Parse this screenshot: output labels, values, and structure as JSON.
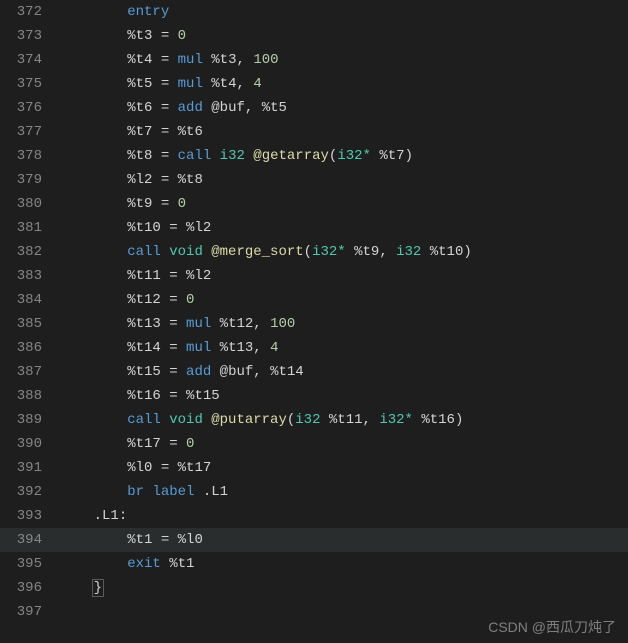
{
  "watermark": "CSDN @西瓜刀炖了",
  "currentLine": 394,
  "lines": [
    {
      "n": 372,
      "indent": 8,
      "tokens": [
        [
          "kw",
          "entry"
        ]
      ]
    },
    {
      "n": 373,
      "indent": 8,
      "tokens": [
        [
          "id",
          "%t3"
        ],
        [
          "op",
          " = "
        ],
        [
          "num",
          "0"
        ]
      ]
    },
    {
      "n": 374,
      "indent": 8,
      "tokens": [
        [
          "id",
          "%t4"
        ],
        [
          "op",
          " = "
        ],
        [
          "kw",
          "mul"
        ],
        [
          "op",
          " "
        ],
        [
          "id",
          "%t3"
        ],
        [
          "pn",
          ", "
        ],
        [
          "num",
          "100"
        ]
      ]
    },
    {
      "n": 375,
      "indent": 8,
      "tokens": [
        [
          "id",
          "%t5"
        ],
        [
          "op",
          " = "
        ],
        [
          "kw",
          "mul"
        ],
        [
          "op",
          " "
        ],
        [
          "id",
          "%t4"
        ],
        [
          "pn",
          ", "
        ],
        [
          "num",
          "4"
        ]
      ]
    },
    {
      "n": 376,
      "indent": 8,
      "tokens": [
        [
          "id",
          "%t6"
        ],
        [
          "op",
          " = "
        ],
        [
          "kw",
          "add"
        ],
        [
          "op",
          " "
        ],
        [
          "id",
          "@buf"
        ],
        [
          "pn",
          ", "
        ],
        [
          "id",
          "%t5"
        ]
      ]
    },
    {
      "n": 377,
      "indent": 8,
      "tokens": [
        [
          "id",
          "%t7"
        ],
        [
          "op",
          " = "
        ],
        [
          "id",
          "%t6"
        ]
      ]
    },
    {
      "n": 378,
      "indent": 8,
      "tokens": [
        [
          "id",
          "%t8"
        ],
        [
          "op",
          " = "
        ],
        [
          "kw",
          "call"
        ],
        [
          "op",
          " "
        ],
        [
          "ty",
          "i32"
        ],
        [
          "op",
          " "
        ],
        [
          "fn",
          "@getarray"
        ],
        [
          "pn",
          "("
        ],
        [
          "ty",
          "i32*"
        ],
        [
          "op",
          " "
        ],
        [
          "id",
          "%t7"
        ],
        [
          "pn",
          ")"
        ]
      ]
    },
    {
      "n": 379,
      "indent": 8,
      "tokens": [
        [
          "id",
          "%l2"
        ],
        [
          "op",
          " = "
        ],
        [
          "id",
          "%t8"
        ]
      ]
    },
    {
      "n": 380,
      "indent": 8,
      "tokens": [
        [
          "id",
          "%t9"
        ],
        [
          "op",
          " = "
        ],
        [
          "num",
          "0"
        ]
      ]
    },
    {
      "n": 381,
      "indent": 8,
      "tokens": [
        [
          "id",
          "%t10"
        ],
        [
          "op",
          " = "
        ],
        [
          "id",
          "%l2"
        ]
      ]
    },
    {
      "n": 382,
      "indent": 8,
      "tokens": [
        [
          "kw",
          "call"
        ],
        [
          "op",
          " "
        ],
        [
          "ty",
          "void"
        ],
        [
          "op",
          " "
        ],
        [
          "fn",
          "@merge_sort"
        ],
        [
          "pn",
          "("
        ],
        [
          "ty",
          "i32*"
        ],
        [
          "op",
          " "
        ],
        [
          "id",
          "%t9"
        ],
        [
          "pn",
          ", "
        ],
        [
          "ty",
          "i32"
        ],
        [
          "op",
          " "
        ],
        [
          "id",
          "%t10"
        ],
        [
          "pn",
          ")"
        ]
      ]
    },
    {
      "n": 383,
      "indent": 8,
      "tokens": [
        [
          "id",
          "%t11"
        ],
        [
          "op",
          " = "
        ],
        [
          "id",
          "%l2"
        ]
      ]
    },
    {
      "n": 384,
      "indent": 8,
      "tokens": [
        [
          "id",
          "%t12"
        ],
        [
          "op",
          " = "
        ],
        [
          "num",
          "0"
        ]
      ]
    },
    {
      "n": 385,
      "indent": 8,
      "tokens": [
        [
          "id",
          "%t13"
        ],
        [
          "op",
          " = "
        ],
        [
          "kw",
          "mul"
        ],
        [
          "op",
          " "
        ],
        [
          "id",
          "%t12"
        ],
        [
          "pn",
          ", "
        ],
        [
          "num",
          "100"
        ]
      ]
    },
    {
      "n": 386,
      "indent": 8,
      "tokens": [
        [
          "id",
          "%t14"
        ],
        [
          "op",
          " = "
        ],
        [
          "kw",
          "mul"
        ],
        [
          "op",
          " "
        ],
        [
          "id",
          "%t13"
        ],
        [
          "pn",
          ", "
        ],
        [
          "num",
          "4"
        ]
      ]
    },
    {
      "n": 387,
      "indent": 8,
      "tokens": [
        [
          "id",
          "%t15"
        ],
        [
          "op",
          " = "
        ],
        [
          "kw",
          "add"
        ],
        [
          "op",
          " "
        ],
        [
          "id",
          "@buf"
        ],
        [
          "pn",
          ", "
        ],
        [
          "id",
          "%t14"
        ]
      ]
    },
    {
      "n": 388,
      "indent": 8,
      "tokens": [
        [
          "id",
          "%t16"
        ],
        [
          "op",
          " = "
        ],
        [
          "id",
          "%t15"
        ]
      ]
    },
    {
      "n": 389,
      "indent": 8,
      "tokens": [
        [
          "kw",
          "call"
        ],
        [
          "op",
          " "
        ],
        [
          "ty",
          "void"
        ],
        [
          "op",
          " "
        ],
        [
          "fn",
          "@putarray"
        ],
        [
          "pn",
          "("
        ],
        [
          "ty",
          "i32"
        ],
        [
          "op",
          " "
        ],
        [
          "id",
          "%t11"
        ],
        [
          "pn",
          ", "
        ],
        [
          "ty",
          "i32*"
        ],
        [
          "op",
          " "
        ],
        [
          "id",
          "%t16"
        ],
        [
          "pn",
          ")"
        ]
      ]
    },
    {
      "n": 390,
      "indent": 8,
      "tokens": [
        [
          "id",
          "%t17"
        ],
        [
          "op",
          " = "
        ],
        [
          "num",
          "0"
        ]
      ]
    },
    {
      "n": 391,
      "indent": 8,
      "tokens": [
        [
          "id",
          "%l0"
        ],
        [
          "op",
          " = "
        ],
        [
          "id",
          "%t17"
        ]
      ]
    },
    {
      "n": 392,
      "indent": 8,
      "tokens": [
        [
          "kw",
          "br"
        ],
        [
          "op",
          " "
        ],
        [
          "kw",
          "label"
        ],
        [
          "op",
          " "
        ],
        [
          "lbl",
          ".L1"
        ]
      ]
    },
    {
      "n": 393,
      "indent": 4,
      "tokens": [
        [
          "lbl",
          ".L1:"
        ]
      ]
    },
    {
      "n": 394,
      "indent": 8,
      "tokens": [
        [
          "id",
          "%t1"
        ],
        [
          "op",
          " = "
        ],
        [
          "id",
          "%l0"
        ]
      ]
    },
    {
      "n": 395,
      "indent": 8,
      "tokens": [
        [
          "kw",
          "exit"
        ],
        [
          "op",
          " "
        ],
        [
          "id",
          "%t1"
        ]
      ]
    },
    {
      "n": 396,
      "indent": 4,
      "tokens": [
        [
          "pn",
          "}"
        ]
      ],
      "braceMatch": true
    },
    {
      "n": 397,
      "indent": 0,
      "tokens": []
    }
  ]
}
